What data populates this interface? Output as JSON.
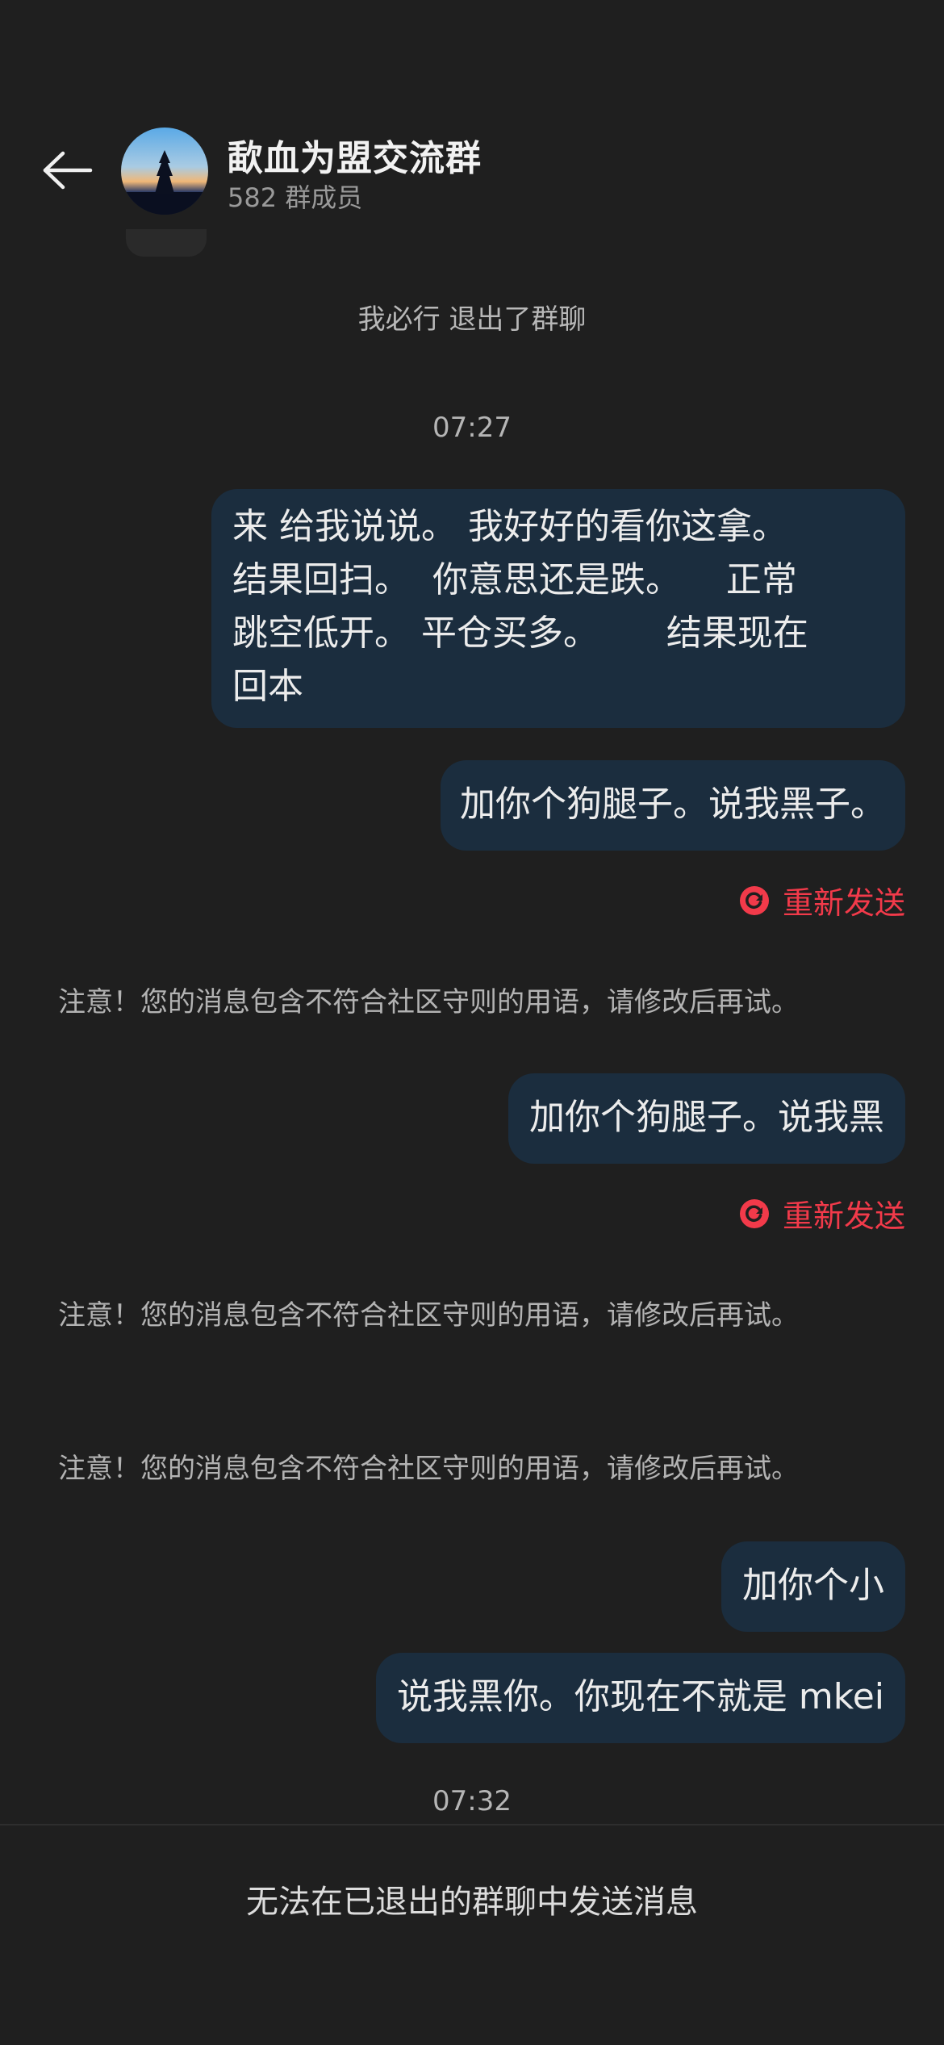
{
  "header": {
    "group_name": "歃血为盟交流群",
    "member_count": "582 群成员"
  },
  "system_event": "我必行 退出了群聊",
  "times": [
    "07:27",
    "07:32"
  ],
  "messages": [
    {
      "lines": [
        "来 给我说说。 我好好的看你这拿。",
        "结果回扫。  你意思还是跌。    正常",
        "跳空低开。 平仓买多。      结果现在",
        "回本"
      ]
    },
    {
      "text": "加你个狗腿子。说我黑子。"
    },
    {
      "text": "加你个狗腿子。说我黑"
    },
    {
      "text": "加你个小"
    },
    {
      "text": "说我黑你。你现在不就是 mkei"
    }
  ],
  "resend_label": "重新发送",
  "warning_text": "注意！您的消息包含不符合社区守则的用语，请修改后再试。",
  "footer_notice": "无法在已退出的群聊中发送消息",
  "colors": {
    "bubble": "#1b2d3e",
    "resend": "#f23a4a",
    "background": "#1f1f1f"
  }
}
